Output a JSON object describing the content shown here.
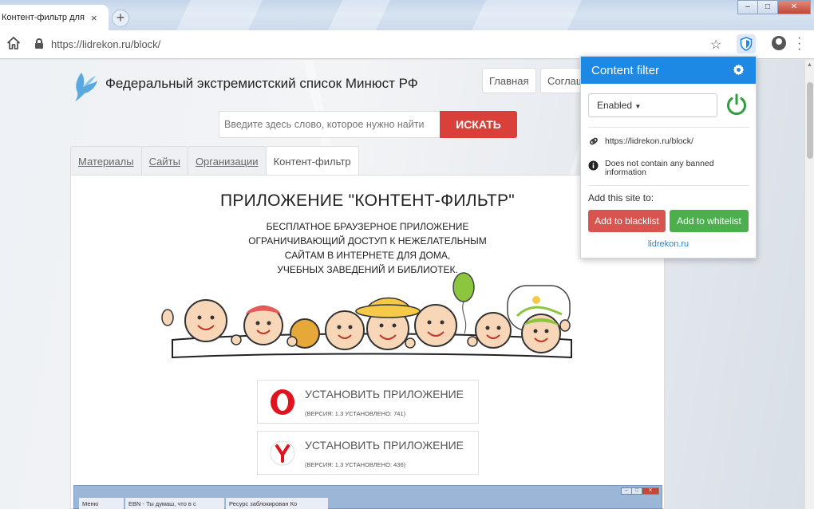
{
  "browser": {
    "tab_title": "Контент-фильтр для",
    "tab_close": "×",
    "new_tab": "+",
    "url": "https://lidrekon.ru/block/",
    "window_controls": {
      "minimize": "–",
      "maximize": "□",
      "close": "✕"
    }
  },
  "site": {
    "title": "Федеральный экстремистский список Минюст РФ",
    "nav": [
      "Главная",
      "Соглаш"
    ],
    "search_placeholder": "Введите здесь слово, которое нужно найти",
    "search_button": "ИСКАТЬ",
    "tabs": [
      "Материалы",
      "Сайты",
      "Организации",
      "Контент-фильтр"
    ],
    "active_tab": "Контент-фильтр"
  },
  "content": {
    "heading": "ПРИЛОЖЕНИЕ \"КОНТЕНТ-ФИЛЬТР\"",
    "description": [
      "БЕСПЛАТНОЕ БРАУЗЕРНОЕ ПРИЛОЖЕНИЕ",
      "ОГРАНИЧИВАЮЩИЙ ДОСТУП К НЕЖЕЛАТЕЛЬНЫМ",
      "САЙТАМ В ИНТЕРНЕТЕ ДЛЯ ДОМА,",
      "УЧЕБНЫХ ЗАВЕДЕНИЙ И БИБЛИОТЕК."
    ],
    "installs": [
      {
        "label": "УСТАНОВИТЬ ПРИЛОЖЕНИЕ",
        "version": "(ВЕРСИЯ: 1.3 УСТАНОВЛЕНО: 741)",
        "icon": "opera-icon"
      },
      {
        "label": "УСТАНОВИТЬ ПРИЛОЖЕНИЕ",
        "version": "(ВЕРСИЯ: 1.3 УСТАНОВЛЕНО: 436)",
        "icon": "yandex-icon"
      }
    ],
    "mini_tabs": [
      "Меню",
      "EBN - Ты думаш, что в с",
      "Ресурс заблокирован Ко"
    ]
  },
  "popup": {
    "title": "Content filter",
    "state": "Enabled",
    "site_url": "https://lidrekon.ru/block/",
    "status": "Does not contain any banned information",
    "add_label": "Add this site to:",
    "blacklist_button": "Add to blacklist",
    "whitelist_button": "Add to whitelist",
    "footer_link": "lidrekon.ru"
  },
  "colors": {
    "popup_header": "#1e88e5",
    "search_button": "#d9403a",
    "blacklist": "#d9534f",
    "whitelist": "#4cae4c",
    "power": "#2e9e3e"
  }
}
